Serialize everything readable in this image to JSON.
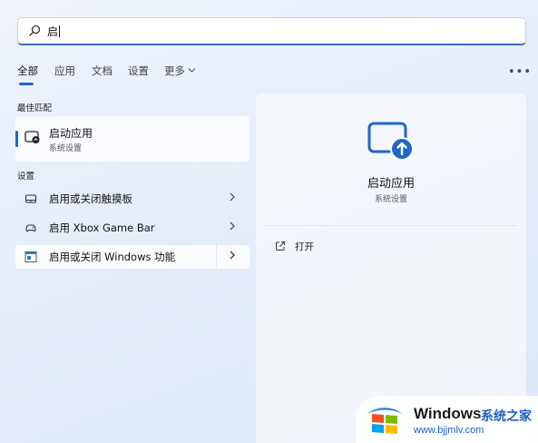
{
  "search": {
    "query": "启"
  },
  "tabs": [
    {
      "label": "全部",
      "active": true
    },
    {
      "label": "应用"
    },
    {
      "label": "文档"
    },
    {
      "label": "设置"
    },
    {
      "label": "更多"
    }
  ],
  "sections": {
    "best_match": "最佳匹配",
    "settings": "设置"
  },
  "best_match": {
    "title": "启动应用",
    "subtitle": "系统设置"
  },
  "settings_results": [
    {
      "label": "启用或关闭触摸板",
      "icon": "touchpad-icon"
    },
    {
      "label": "启用 Xbox Game Bar",
      "icon": "gamebar-icon"
    },
    {
      "label": "启用或关闭 Windows 功能",
      "icon": "windows-features-icon"
    }
  ],
  "detail": {
    "title": "启动应用",
    "subtitle": "系统设置",
    "action_open": "打开"
  },
  "watermark": {
    "brand": "Windows",
    "cn": "系统之家",
    "url": "www.bjjmlv.com"
  },
  "colors": {
    "accent": "#1f66c9"
  }
}
